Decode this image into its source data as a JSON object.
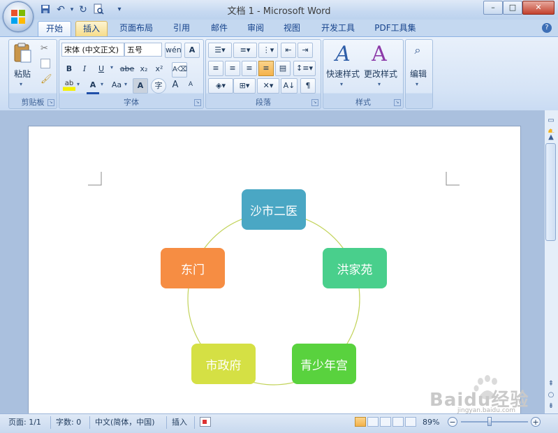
{
  "window": {
    "title": "文档 1 - Microsoft Word",
    "minimize": "–",
    "maximize": "□",
    "close": "✕"
  },
  "quick_access": [
    "save-icon",
    "undo-icon",
    "redo-icon",
    "print-preview-icon",
    "customize-qat-icon"
  ],
  "tabs": [
    {
      "label": "开始",
      "state": "active"
    },
    {
      "label": "插入",
      "state": "hover"
    },
    {
      "label": "页面布局",
      "state": "normal"
    },
    {
      "label": "引用",
      "state": "normal"
    },
    {
      "label": "邮件",
      "state": "normal"
    },
    {
      "label": "审阅",
      "state": "normal"
    },
    {
      "label": "视图",
      "state": "normal"
    },
    {
      "label": "开发工具",
      "state": "normal"
    },
    {
      "label": "PDF工具集",
      "state": "normal"
    }
  ],
  "ribbon": {
    "clipboard": {
      "label": "剪贴板",
      "paste": "粘贴"
    },
    "font": {
      "label": "字体",
      "font_name": "宋体 (中文正文)",
      "font_size": "五号",
      "bold": "B",
      "italic": "I",
      "underline": "U",
      "strike": "abe",
      "subscript": "x₂",
      "superscript": "x²",
      "change_case": "Aa",
      "grow": "A",
      "shrink": "A",
      "char_border": "A",
      "font_color": "A"
    },
    "paragraph": {
      "label": "段落"
    },
    "styles": {
      "label": "样式",
      "quick_styles": "快速样式",
      "change_styles": "更改样式"
    },
    "editing": {
      "label": "编辑"
    }
  },
  "smartart": {
    "colors": {
      "cycle": "#c2d35a",
      "top": "#4aa7c4",
      "right": "#49cf8c",
      "bottom_right": "#59d23e",
      "bottom_left": "#d5e044",
      "left": "#f68d43"
    },
    "nodes": [
      {
        "id": "top",
        "label": "沙市二医"
      },
      {
        "id": "right",
        "label": "洪家苑"
      },
      {
        "id": "bottom_right",
        "label": "青少年宫"
      },
      {
        "id": "bottom_left",
        "label": "市政府"
      },
      {
        "id": "left",
        "label": "东门"
      }
    ]
  },
  "status": {
    "page": "页面: 1/1",
    "words": "字数: 0",
    "language": "中文(简体，中国)",
    "mode": "插入",
    "zoom": "89%"
  },
  "watermark": {
    "text": "Baidu经验",
    "url": "jingyan.baidu.com"
  }
}
